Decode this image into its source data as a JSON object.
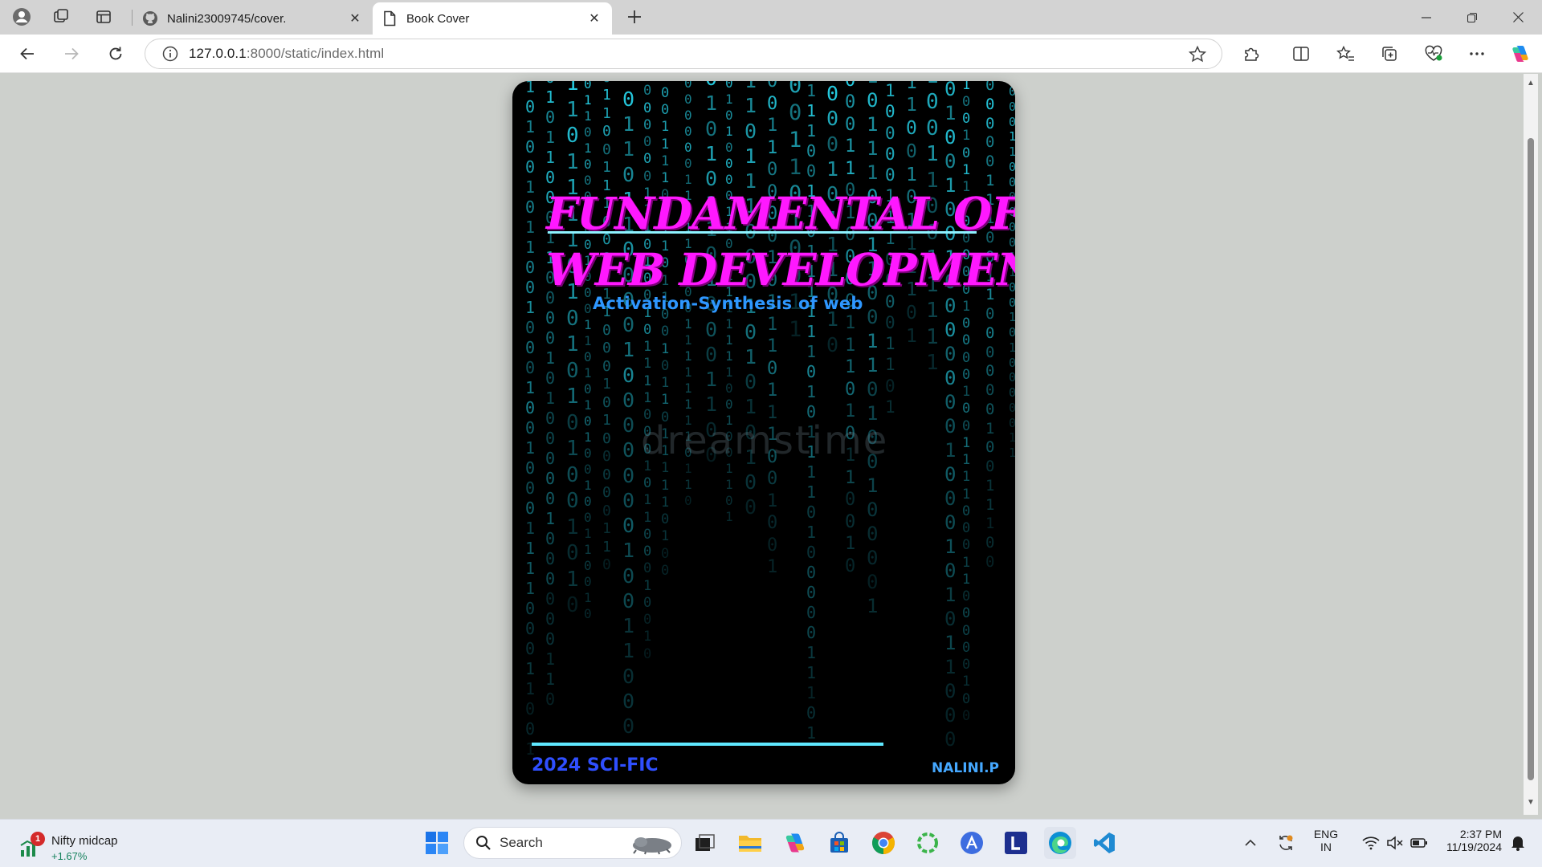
{
  "browser": {
    "tabs": [
      {
        "title": "Nalini23009745/cover.",
        "icon": "github-icon",
        "active": false
      },
      {
        "title": "Book Cover",
        "icon": "page-icon",
        "active": true
      }
    ],
    "new_tab_label": "+",
    "close_glyph": "✕",
    "address": {
      "host": "127.0.0.1",
      "rest": ":8000/static/index.html"
    }
  },
  "book_cover": {
    "title_line1": "FUNDAMENTAL OF",
    "title_line2": "WEB DEVELOPMENT",
    "subtitle": "Activation-Synthesis of web",
    "edition": "2024 SCI-FIC",
    "author": "NALINI.P",
    "watermark": "dreamstime",
    "colors": {
      "title": "#ff18ff",
      "subtitle": "#2e97ff",
      "digits": "#28d9f0",
      "rule": "#5fe8ff",
      "edition": "#2f4fff",
      "author": "#45a8ff"
    }
  },
  "taskbar": {
    "widget": {
      "name": "Nifty midcap",
      "change": "+1.67%",
      "badge": "1"
    },
    "search_label": "Search",
    "language": {
      "line1": "ENG",
      "line2": "IN"
    },
    "clock": {
      "time": "2:37 PM",
      "date": "11/19/2024"
    }
  }
}
